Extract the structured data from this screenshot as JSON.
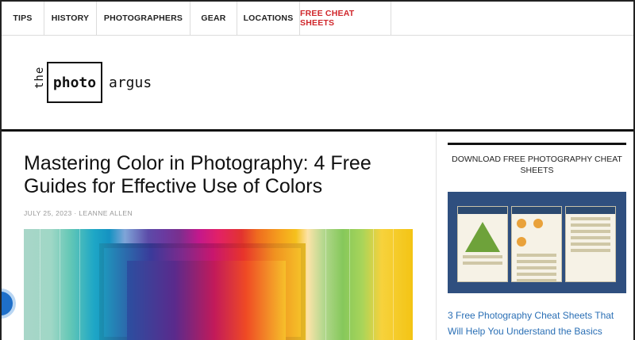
{
  "nav": {
    "items": [
      "TIPS",
      "HISTORY",
      "PHOTOGRAPHERS",
      "GEAR",
      "LOCATIONS",
      "FREE CHEAT SHEETS"
    ]
  },
  "logo": {
    "the": "the",
    "photo": "photo",
    "argus": "argus"
  },
  "article": {
    "title": "Mastering Color in Photography: 4 Free Guides for Effective Use of Colors",
    "meta": "JULY 25, 2023 · LEANNE ALLEN"
  },
  "sidebar": {
    "widget_title": "DOWNLOAD FREE PHOTOGRAPHY CHEAT SHEETS",
    "link_text": "3 Free Photography Cheat Sheets That Will Help You Understand the Basics"
  },
  "colors": {
    "accent": "#d0262b",
    "link": "#2a6fb5",
    "rule": "#111111"
  }
}
